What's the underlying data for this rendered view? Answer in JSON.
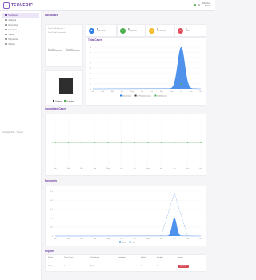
{
  "app": {
    "logo_text": "TEOVERIC",
    "user_name": "John Doe",
    "user_role": "Admin"
  },
  "sidebar": {
    "items": [
      {
        "label": "Dashboard",
        "icon": "dashboard-icon",
        "active": true
      },
      {
        "label": "Analysis",
        "icon": "analysis-icon"
      },
      {
        "label": "Recruiting",
        "icon": "recruiting-icon"
      },
      {
        "label": "Interview",
        "icon": "interview-icon"
      },
      {
        "label": "Users",
        "icon": "users-icon"
      },
      {
        "label": "Payments",
        "icon": "payments-icon"
      },
      {
        "label": "Setting",
        "icon": "gear-icon"
      }
    ],
    "copyright": "Copyright 2021 - Teoveric"
  },
  "dashboard": {
    "title": "Dashboard",
    "info_card": {
      "line1": "Total Credit Balance: --",
      "line2": "Total Credit Consumed: --",
      "date_from": "Start date",
      "date_to": "End date"
    },
    "stats": [
      {
        "value": "8",
        "label": "Total Cases",
        "color": "#2f7fe8"
      },
      {
        "value": "8",
        "label": "Completed",
        "color": "#4caf50"
      },
      {
        "value": "0",
        "label": "In Progress",
        "color": "#f5b820"
      },
      {
        "value": "0",
        "label": "Failed",
        "color": "#e04b5a"
      }
    ],
    "pie_legend": [
      {
        "label": "Pending",
        "color": "#333333"
      },
      {
        "label": "Complete",
        "color": "#4caf50"
      }
    ]
  },
  "colors": {
    "accent": "#6b3fa0",
    "blue": "#2f7fe8",
    "green": "#4caf50",
    "red": "#d94c5a"
  },
  "chart_data": [
    {
      "type": "area",
      "title": "Total Cases",
      "x": [
        "Jan",
        "Feb",
        "Mar",
        "Apr",
        "May",
        "Jun",
        "Jul",
        "Aug",
        "Sep",
        "Oct",
        "Nov",
        "Dec"
      ],
      "series": [
        {
          "name": "Total Cases",
          "values": [
            0,
            0,
            0,
            0,
            0,
            0,
            0,
            0,
            0,
            8,
            0,
            0
          ],
          "color": "#2f7fe8"
        },
        {
          "name": "In Progress Cases",
          "values": [
            0,
            0,
            0,
            0,
            0,
            0,
            0,
            0,
            0,
            0,
            0,
            0
          ],
          "color": "#333333"
        },
        {
          "name": "Failed Cases",
          "values": [
            0,
            0,
            0,
            0,
            0,
            0,
            0,
            0,
            0,
            0,
            0,
            0
          ],
          "color": "#4caf50"
        }
      ],
      "ylim": [
        0,
        8
      ],
      "yticks": [
        "0",
        "1",
        "2",
        "3",
        "4",
        "5",
        "6",
        "7",
        "8"
      ],
      "legend": "bottom"
    },
    {
      "type": "line",
      "title": "Completed Cases",
      "x": [
        "Jan",
        "Feb",
        "Mar",
        "Apr",
        "May",
        "Jun",
        "Jul",
        "Aug",
        "Sep",
        "Oct",
        "Nov",
        "Dec"
      ],
      "series": [
        {
          "name": "",
          "values": [
            0,
            0,
            0,
            0,
            0,
            0,
            0,
            0,
            0,
            0,
            0,
            0
          ],
          "color": "#4caf50"
        }
      ],
      "yticks": [
        "0"
      ],
      "grid": true
    },
    {
      "type": "area",
      "title": "Payments",
      "x": [
        "Jan",
        "Feb",
        "Mar",
        "Apr",
        "May",
        "Jun",
        "Jul",
        "Aug",
        "Sep",
        "Oct",
        "Nov",
        "Dec"
      ],
      "series": [
        {
          "name": "Spent",
          "values": [
            0,
            0,
            0,
            0,
            0,
            0,
            0,
            0,
            0,
            1,
            0,
            0
          ],
          "color": "#2f7fe8"
        },
        {
          "name": "Total",
          "values": [
            0,
            0,
            0,
            0,
            0,
            0,
            0,
            0,
            0,
            2.4,
            0,
            0
          ],
          "color": "#2f7fe8"
        }
      ],
      "ylim": [
        0,
        2.5
      ],
      "yticks": [
        "0",
        "0.5",
        "1.0",
        "1.5",
        "2.0",
        "2.5"
      ],
      "legend": "bottom"
    }
  ],
  "report_table": {
    "title": "Reports",
    "headers": [
      "Month",
      "Total Cases",
      "Total Spent",
      "Completed",
      "Failed",
      "Pending",
      "Report"
    ],
    "rows": [
      {
        "month": "NAN",
        "total_cases": "1",
        "total_spent": "$0.00",
        "completed": "0",
        "failed": "0",
        "pending": "1",
        "report_label": "Report"
      }
    ]
  }
}
